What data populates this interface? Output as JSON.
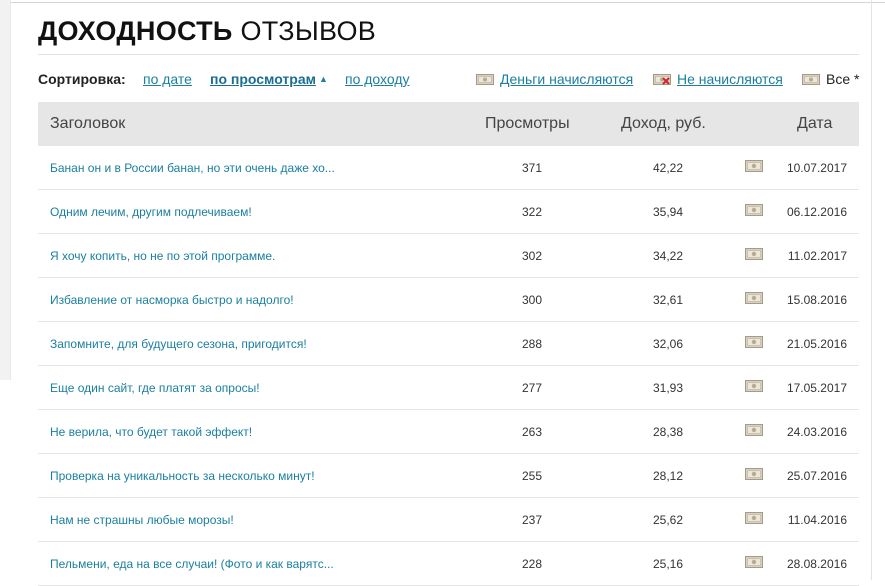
{
  "page": {
    "title_bold": "ДОХОДНОСТЬ",
    "title_light": "ОТЗЫВОВ"
  },
  "sort": {
    "label": "Сортировка:",
    "by_date": "по дате",
    "by_views": "по просмотрам",
    "by_income": "по доходу",
    "active": "by_views"
  },
  "filters": {
    "money_on": "Деньги начисляются",
    "money_off": "Не начисляются",
    "all": "Все *"
  },
  "table": {
    "columns": [
      "Заголовок",
      "Просмотры",
      "Доход, руб.",
      "Дата"
    ],
    "rows": [
      {
        "title": "Банан он и в России банан, но эти очень даже хо...",
        "views": "371",
        "income": "42,22",
        "date": "10.07.2017"
      },
      {
        "title": "Одним лечим, другим подлечиваем!",
        "views": "322",
        "income": "35,94",
        "date": "06.12.2016"
      },
      {
        "title": "Я хочу копить, но не по этой программе.",
        "views": "302",
        "income": "34,22",
        "date": "11.02.2017"
      },
      {
        "title": "Избавление от насморка быстро и надолго!",
        "views": "300",
        "income": "32,61",
        "date": "15.08.2016"
      },
      {
        "title": "Запомните, для будущего сезона, пригодится!",
        "views": "288",
        "income": "32,06",
        "date": "21.05.2016"
      },
      {
        "title": "Еще один сайт, где платят за опросы!",
        "views": "277",
        "income": "31,93",
        "date": "17.05.2017"
      },
      {
        "title": "Не верила, что будет такой эффект!",
        "views": "263",
        "income": "28,38",
        "date": "24.03.2016"
      },
      {
        "title": "Проверка на уникальность за несколько минут!",
        "views": "255",
        "income": "28,12",
        "date": "25.07.2016"
      },
      {
        "title": "Нам не страшны любые морозы!",
        "views": "237",
        "income": "25,62",
        "date": "11.04.2016"
      },
      {
        "title": "Пельмени, еда на все случаи! (Фото и как варятс...",
        "views": "228",
        "income": "25,16",
        "date": "28.08.2016"
      }
    ]
  },
  "icons": {
    "money_status": "money-note-icon"
  },
  "colors": {
    "link": "#1a7fa0",
    "header_bg": "#e6e6e6"
  }
}
